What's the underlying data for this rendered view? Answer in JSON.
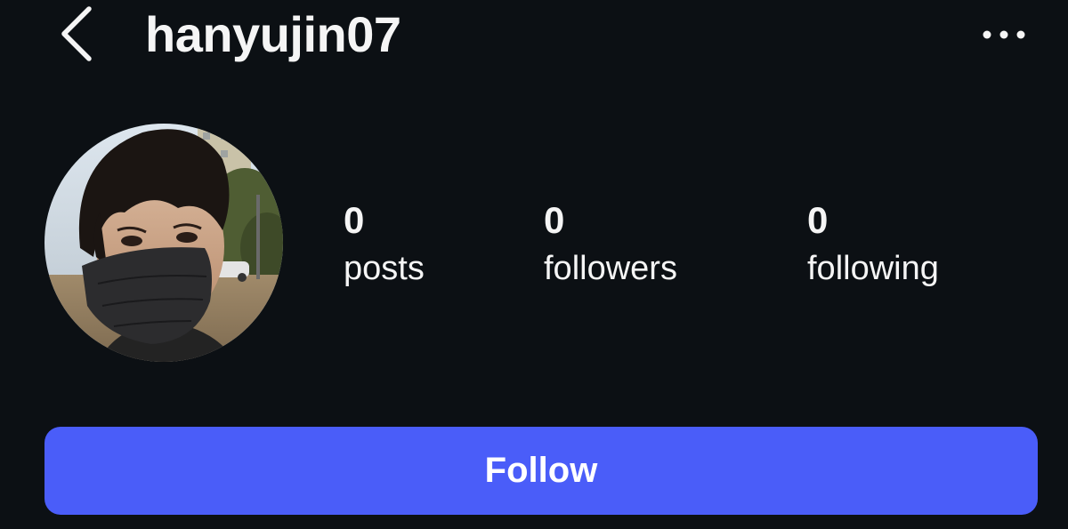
{
  "header": {
    "username": "hanyujin07",
    "back_icon": "chevron-left-icon",
    "more_icon": "more-horizontal-icon"
  },
  "profile": {
    "avatar_icon": "profile-photo",
    "stats": {
      "posts": {
        "count": "0",
        "label": "posts"
      },
      "followers": {
        "count": "0",
        "label": "followers"
      },
      "following": {
        "count": "0",
        "label": "following"
      }
    }
  },
  "actions": {
    "follow_label": "Follow"
  },
  "colors": {
    "background": "#0c1014",
    "text": "#f5f5f5",
    "accent": "#4a5df9"
  }
}
